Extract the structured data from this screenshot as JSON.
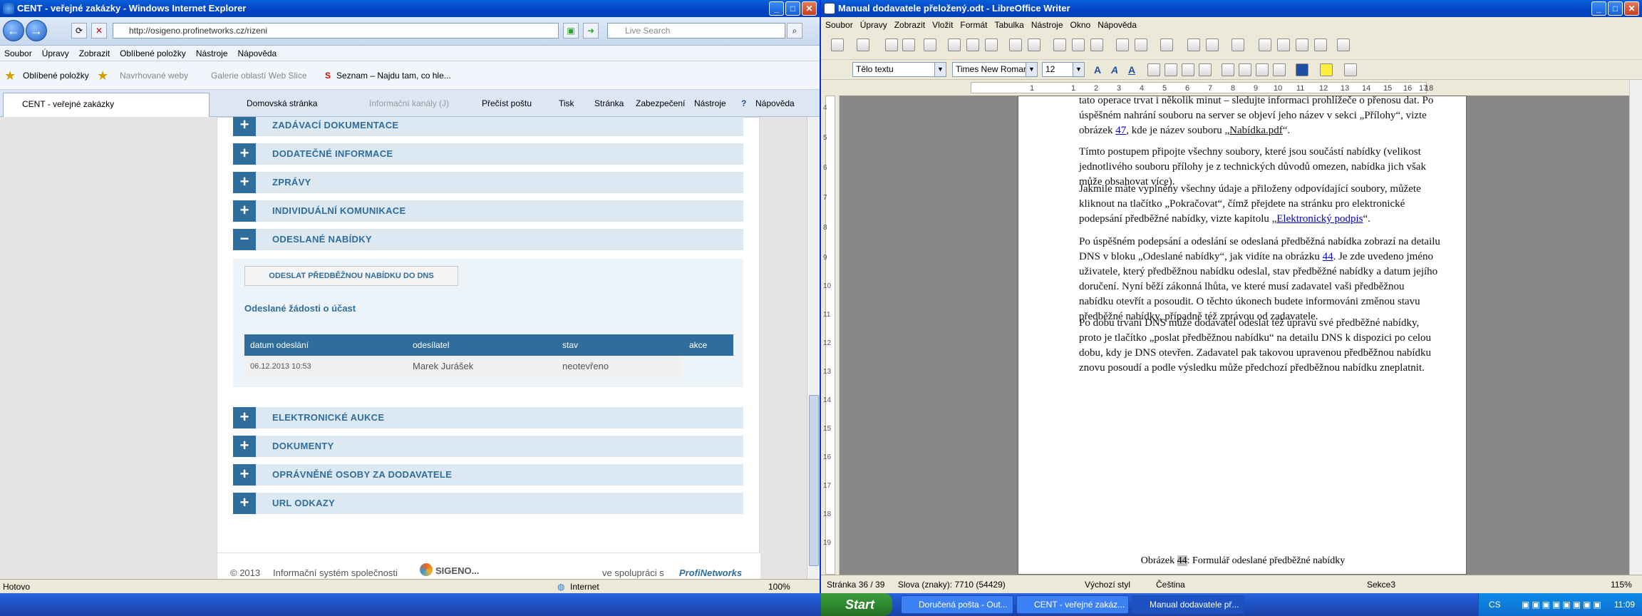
{
  "ie": {
    "title": "CENT - veřejné zakázky - Windows Internet Explorer",
    "address": "http://osigeno.profinetworks.cz/rizeni",
    "search_placeholder": "Live Search",
    "menu": [
      "Soubor",
      "Úpravy",
      "Zobrazit",
      "Oblíbené položky",
      "Nástroje",
      "Nápověda"
    ],
    "favorites": {
      "main": "Oblíbené položky",
      "suggested": "Navrhované weby",
      "gallery": "Galerie oblastí Web Slice",
      "seznam": "Seznam – Najdu tam, co hle..."
    },
    "tab": "CENT - veřejné zakázky",
    "commands": [
      "Domovská stránka",
      "Informační kanály (J)",
      "Přečíst poštu",
      "Tisk",
      "Stránka",
      "Zabezpečení",
      "Nástroje",
      "Nápověda"
    ],
    "status": {
      "left": "Hotovo",
      "zone": "Internet",
      "zoom": "100%"
    },
    "page": {
      "sections_top": [
        {
          "pm": "+",
          "label": "ZADÁVACÍ DOKUMENTACE"
        },
        {
          "pm": "+",
          "label": "DODATEČNÉ INFORMACE"
        },
        {
          "pm": "+",
          "label": "ZPRÁVY"
        },
        {
          "pm": "+",
          "label": "INDIVIDUÁLNÍ KOMUNIKACE"
        },
        {
          "pm": "−",
          "label": "ODESLANÉ NABÍDKY"
        }
      ],
      "send_button": "ODESLAT PŘEDBĚŽNOU NABÍDKU DO DNS",
      "subtitle": "Odeslané žádosti o účast",
      "table": {
        "headers": [
          "datum odeslání",
          "odesílatel",
          "stav",
          "akce"
        ],
        "row": [
          "06.12.2013 10:53",
          "Marek Jurášek",
          "neotevřeno",
          ""
        ]
      },
      "sections_bottom": [
        {
          "pm": "+",
          "label": "ELEKTRONICKÉ AUKCE"
        },
        {
          "pm": "+",
          "label": "DOKUMENTY"
        },
        {
          "pm": "+",
          "label": "OPRÁVNĚNÉ OSOBY ZA DODAVATELE"
        },
        {
          "pm": "+",
          "label": "URL ODKAZY"
        }
      ],
      "footer": {
        "copyright": "© 2013",
        "system": "Informační systém společnosti",
        "brand": "SIGENO...",
        "coop": "ve spolupráci s",
        "partner": "ProfiNetworks"
      }
    }
  },
  "lo": {
    "title": "Manual dodavatele přeložený.odt - LibreOffice Writer",
    "menu": [
      "Soubor",
      "Úpravy",
      "Zobrazit",
      "Vložit",
      "Formát",
      "Tabulka",
      "Nástroje",
      "Okno",
      "Nápověda"
    ],
    "style": "Tělo textu",
    "font": "Times New Roman",
    "size": "12",
    "ruler": [
      "1",
      "1",
      "2",
      "3",
      "4",
      "5",
      "6",
      "7",
      "8",
      "9",
      "10",
      "11",
      "12",
      "13",
      "14",
      "15",
      "16",
      "17",
      "18"
    ],
    "vruler": [
      "4",
      "5",
      "6",
      "7",
      "8",
      "9",
      "10",
      "11",
      "12",
      "13",
      "14",
      "15",
      "16",
      "17",
      "18",
      "19"
    ],
    "p1a": "tato operace trvat i několik minut – sledujte informaci prohlížeče o přenosu dat. Po úspěšném nahrání souboru na server se objeví jeho název v sekci „Přílohy“, vizte obrázek ",
    "p1link": "47",
    "p1b": ", kde je název souboru „",
    "p1file": "Nabídka.pdf",
    "p1c": "“.",
    "p2": "Tímto postupem připojte všechny soubory, které jsou součástí nabídky (velikost jednotlivého souboru přílohy je z technických důvodů omezen, nabídka jich však může obsahovat více).",
    "p3a": "Jakmile máte vyplněny všechny údaje a přiloženy odpovídající soubory, můžete kliknout na tlačítko „Pokračovat“, čímž přejdete na stránku pro elektronické podepsání předběžné nabídky, vizte kapitolu „",
    "p3link": "Elektronický podpis",
    "p3b": "“.",
    "p4a": "Po úspěšném podepsání a odeslání se odeslaná předběžná nabídka zobrazí na detailu DNS v bloku „Odeslané nabídky“, jak vidíte na obrázku ",
    "p4link": "44",
    "p4b": ". Je zde uvedeno jméno uživatele, který předběžnou nabídku odeslal, stav předběžné nabídky a datum jejího doručení. Nyní běží zákonná lhůta, ve které musí zadavatel vaši předběžnou nabídku otevřít a posoudit. O těchto úkonech budete informováni změnou stavu předběžné nabídky, případně též zprávou od zadavatele.",
    "p5": "Po dobu trvání DNS může dodavatel odeslat též úpravu své předběžné nabídky, proto je tlačítko „poslat předběžnou nabídku“ na detailu DNS k dispozici po celou dobu, kdy je DNS otevřen. Zadavatel pak takovou upravenou předběžnou nabídku znovu posoudí a podle výsledku může předchozí předběžnou nabídku zneplatnit.",
    "caption_pre": "Obrázek ",
    "caption_num": "44",
    "caption_post": ": Formulář odeslané předběžné nabídky",
    "status": {
      "page": "Stránka 36 / 39",
      "words": "Slova (znaky): 7710 (54429)",
      "style": "Výchozí styl",
      "lang": "Čeština",
      "section": "Sekce3",
      "zoom": "115%"
    }
  },
  "taskbar": {
    "start": "Start",
    "tasks": [
      "Doručená pošta - Out...",
      "CENT - veřejné zakáz...",
      "Manual dodavatele př..."
    ],
    "lang": "CS",
    "time": "11:09"
  }
}
